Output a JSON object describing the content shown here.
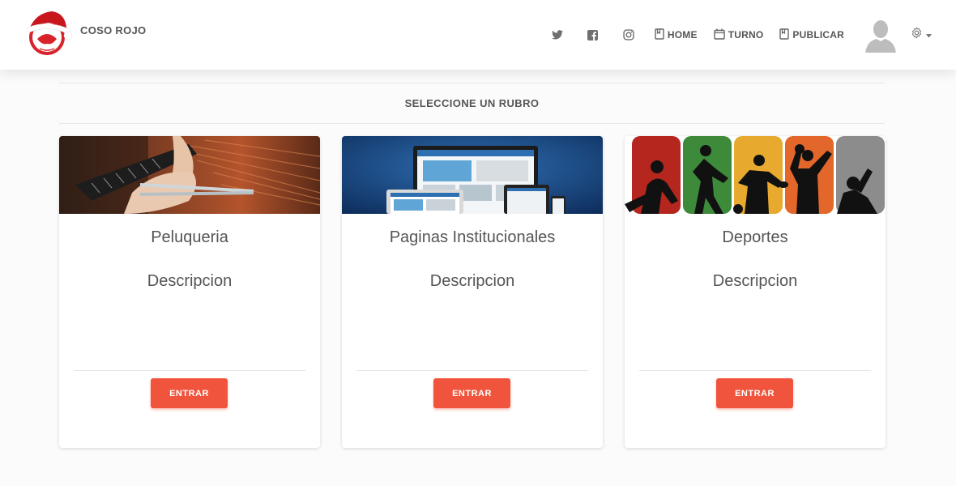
{
  "brand": {
    "name": "COSO ROJO",
    "logo_icon": "santa-hat-logo-icon"
  },
  "nav": {
    "social_icons": [
      "twitter-icon",
      "facebook-icon",
      "instagram-icon"
    ],
    "links": [
      {
        "label": "HOME",
        "icon": "bookmark-icon"
      },
      {
        "label": "TURNO",
        "icon": "calendar-icon"
      },
      {
        "label": "PUBLICAR",
        "icon": "bookmark-icon"
      }
    ],
    "avatar_icon": "user-avatar-icon",
    "settings_icon": "gear-icon",
    "caret_icon": "caret-down-icon"
  },
  "section": {
    "title": "SELECCIONE UN RUBRO"
  },
  "cards": [
    {
      "title": "Peluqueria",
      "description": "Descripcion",
      "button": "ENTRAR",
      "image": "haircut-photo"
    },
    {
      "title": "Paginas Institucionales",
      "description": "Descripcion",
      "button": "ENTRAR",
      "image": "responsive-websites-photo"
    },
    {
      "title": "Deportes",
      "description": "Descripcion",
      "button": "ENTRAR",
      "image": "sports-silhouettes-photo"
    }
  ],
  "colors": {
    "accent": "#f0543c",
    "text": "#555555",
    "background": "#fbfbfb"
  }
}
